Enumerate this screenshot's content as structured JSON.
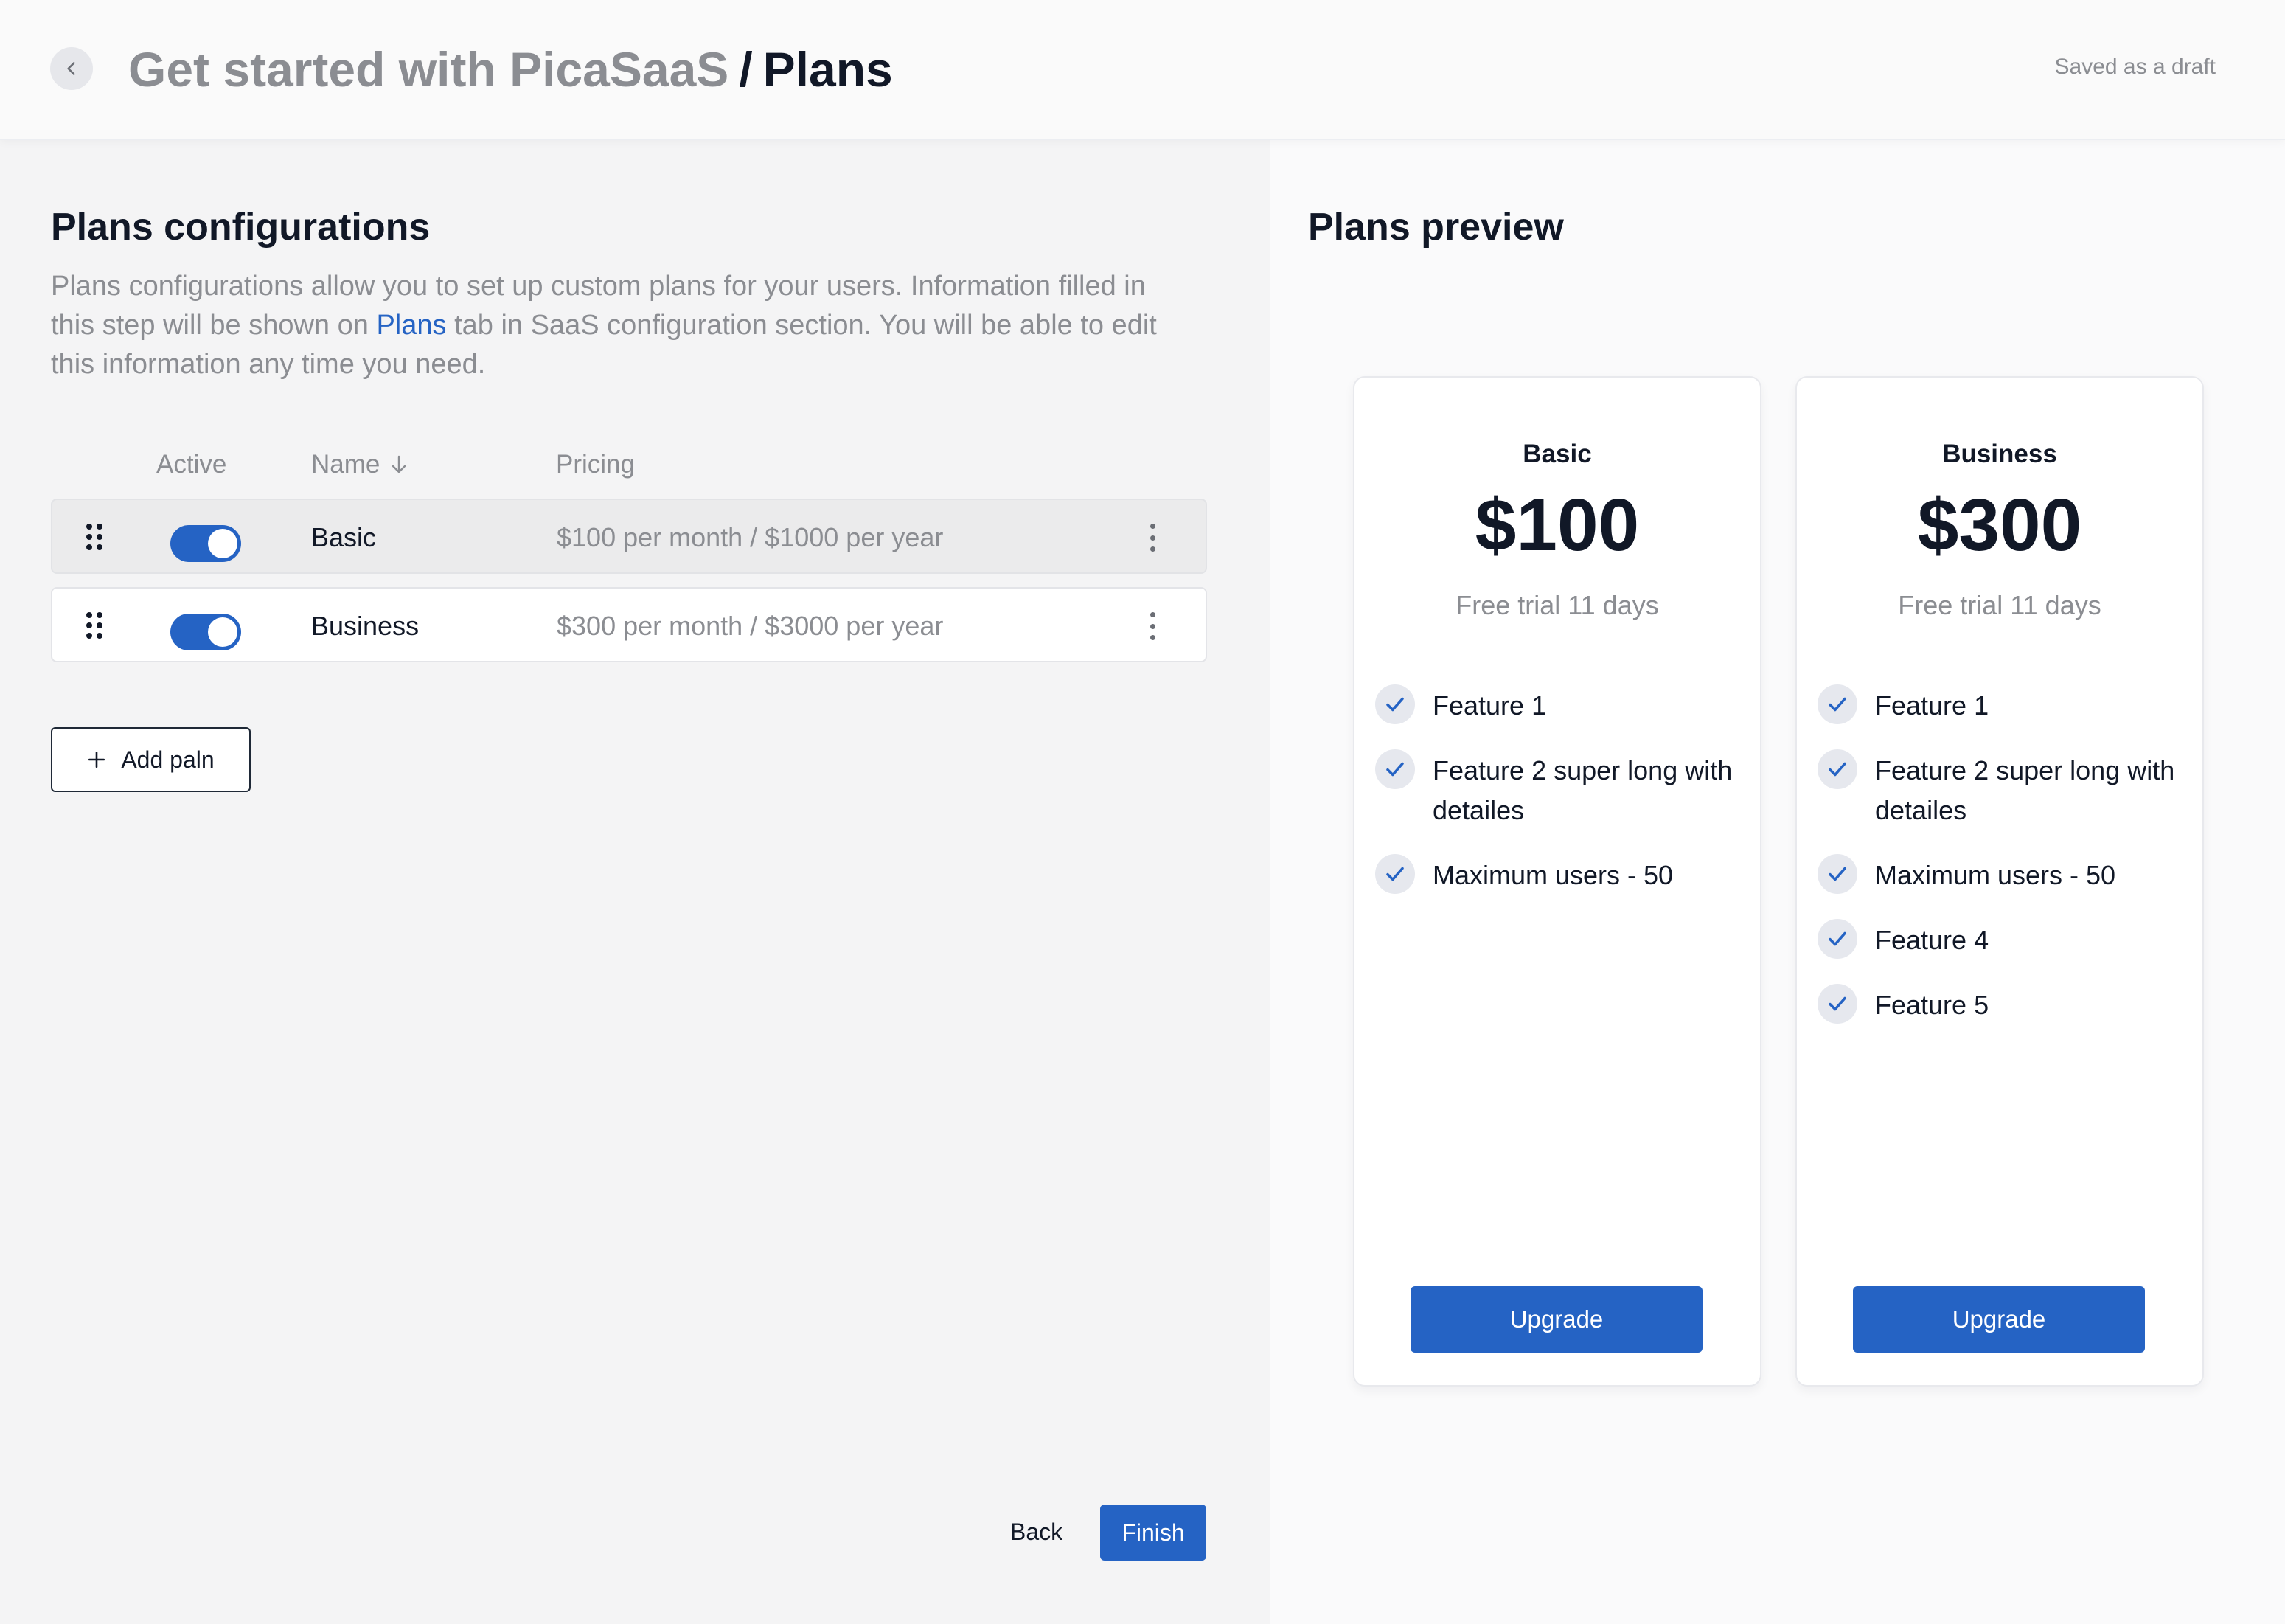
{
  "header": {
    "breadcrumb_parent": "Get started with PicaSaaS",
    "separator": "/",
    "current": "Plans",
    "status": "Saved as a draft"
  },
  "config": {
    "title": "Plans configurations",
    "desc_before": "Plans configurations allow you to set up custom plans for your users. Information filled in this step will be shown on ",
    "desc_link": "Plans",
    "desc_after": " tab in SaaS configuration section. You will be able to edit this information any time you need.",
    "columns": {
      "active": "Active",
      "name": "Name",
      "pricing": "Pricing"
    },
    "rows": [
      {
        "name": "Basic",
        "pricing": "$100 per month / $1000 per year",
        "active": true
      },
      {
        "name": "Business",
        "pricing": "$300 per month / $3000 per year",
        "active": true
      }
    ],
    "add_label": "Add paln",
    "back_label": "Back",
    "finish_label": "Finish"
  },
  "preview": {
    "title": "Plans preview",
    "cards": [
      {
        "name": "Basic",
        "price": "$100",
        "trial": "Free trial 11 days",
        "features": [
          "Feature 1",
          "Feature 2 super long with detailes",
          "Maximum users - 50"
        ],
        "button": "Upgrade"
      },
      {
        "name": "Business",
        "price": "$300",
        "trial": "Free trial 11 days",
        "features": [
          "Feature 1",
          "Feature 2 super long with detailes",
          "Maximum users - 50",
          "Feature 4",
          "Feature 5"
        ],
        "button": "Upgrade"
      }
    ]
  },
  "colors": {
    "accent": "#2563c4",
    "muted_text": "#8b8d92",
    "text": "#111827"
  }
}
